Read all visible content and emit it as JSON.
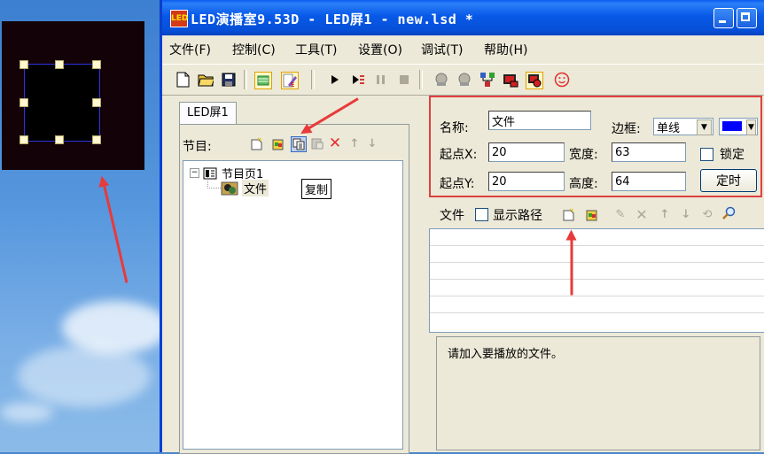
{
  "window": {
    "title": "LED演播室9.53D - LED屏1 - new.lsd *",
    "app_icon_label": "LED"
  },
  "menu": [
    "文件(F)",
    "控制(C)",
    "工具(T)",
    "设置(O)",
    "调试(T)",
    "帮助(H)"
  ],
  "toolbar": {
    "icons": [
      "new-file-icon",
      "open-folder-icon",
      "save-icon",
      "screen-grid-icon",
      "edit-icon",
      "play-icon",
      "step-icon",
      "pause-icon",
      "stop-icon",
      "record-icon",
      "lock-icon",
      "network-icon",
      "send-icon",
      "capture-icon",
      "smiley-icon"
    ]
  },
  "left_panel": {
    "tab_label": "LED屏1",
    "program_label": "节目:",
    "tree": {
      "root_label": "节目页1",
      "expander": "−",
      "child_label": "文件"
    },
    "tooltip": "复制"
  },
  "properties": {
    "name_label": "名称:",
    "name_value": "文件",
    "border_label": "边框:",
    "border_value": "单线",
    "border_color": "#0000ff",
    "x_label": "起点X:",
    "x_value": "20",
    "width_label": "宽度:",
    "width_value": "63",
    "lock_label": "锁定",
    "y_label": "起点Y:",
    "y_value": "20",
    "height_label": "高度:",
    "height_value": "64",
    "timer_button": "定时"
  },
  "file_section": {
    "label": "文件",
    "show_path_label": "显示路径",
    "message": "请加入要播放的文件。"
  },
  "colors": {
    "titlebar": "#0a5bf0",
    "annotation": "#e83a3a",
    "led_background": "#130308"
  }
}
